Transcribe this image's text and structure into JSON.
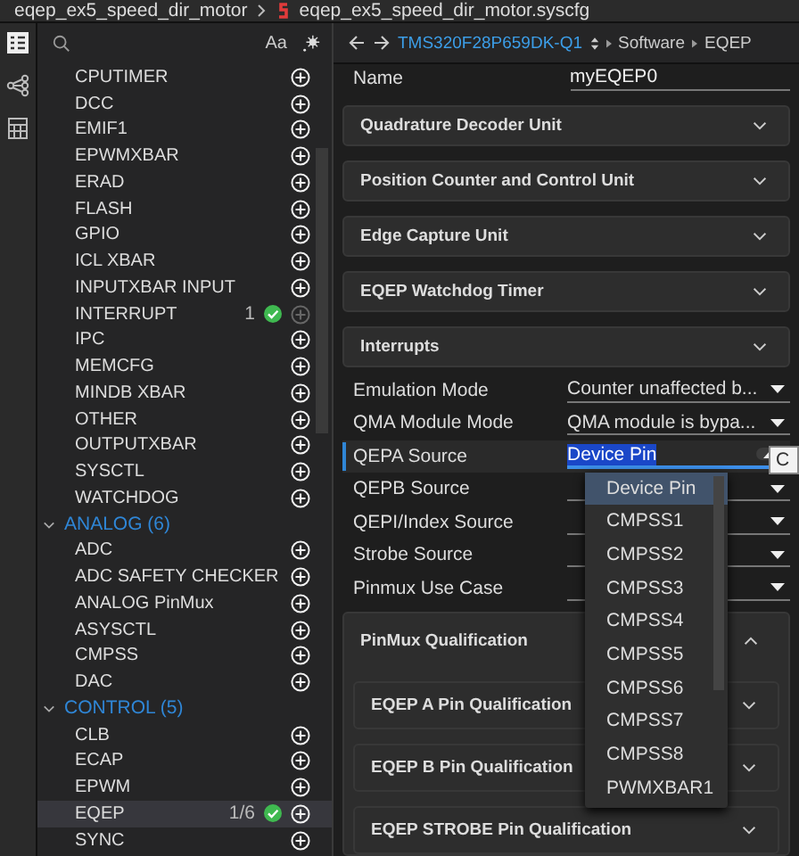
{
  "tabs": [
    {
      "label": "eqep_ex5_speed_dir_motor"
    },
    {
      "label": "eqep_ex5_speed_dir_motor.syscfg"
    }
  ],
  "search": {
    "case_label": "Aa"
  },
  "modules": [
    {
      "label": "CPUTIMER",
      "selected": false
    },
    {
      "label": "DCC",
      "selected": false
    },
    {
      "label": "EMIF1",
      "selected": false
    },
    {
      "label": "EPWMXBAR",
      "selected": false
    },
    {
      "label": "ERAD",
      "selected": false
    },
    {
      "label": "FLASH",
      "selected": false
    },
    {
      "label": "GPIO",
      "selected": false
    },
    {
      "label": "ICL XBAR",
      "selected": false
    },
    {
      "label": "INPUTXBAR INPUT",
      "selected": false
    },
    {
      "label": "INTERRUPT",
      "count": "1",
      "added": true,
      "add_disabled": true,
      "selected": false
    },
    {
      "label": "IPC",
      "selected": false
    },
    {
      "label": "MEMCFG",
      "selected": false
    },
    {
      "label": "MINDB XBAR",
      "selected": false
    },
    {
      "label": "OTHER",
      "selected": false
    },
    {
      "label": "OUTPUTXBAR",
      "selected": false
    },
    {
      "label": "SYSCTL",
      "selected": false
    },
    {
      "label": "WATCHDOG",
      "selected": false
    }
  ],
  "categories": [
    {
      "label": "ANALOG (6)",
      "expanded": true,
      "children": [
        {
          "label": "ADC",
          "selected": false
        },
        {
          "label": "ADC SAFETY CHECKER",
          "selected": false
        },
        {
          "label": "ANALOG PinMux",
          "selected": false
        },
        {
          "label": "ASYSCTL",
          "selected": false
        },
        {
          "label": "CMPSS",
          "selected": false
        },
        {
          "label": "DAC",
          "selected": false
        }
      ]
    },
    {
      "label": "CONTROL (5)",
      "expanded": true,
      "children": [
        {
          "label": "CLB",
          "selected": false
        },
        {
          "label": "ECAP",
          "selected": false
        },
        {
          "label": "EPWM",
          "selected": false
        },
        {
          "label": "EQEP",
          "count": "1/6",
          "added": true,
          "selected": true
        },
        {
          "label": "SYNC",
          "selected": false
        }
      ]
    }
  ],
  "breadcrumb": {
    "device": "TMS320F28P659DK-Q1",
    "path": [
      "Software",
      "EQEP"
    ]
  },
  "name_field": {
    "label": "Name",
    "value": "myEQEP0"
  },
  "sections": [
    {
      "title": "Quadrature Decoder Unit",
      "expanded": false
    },
    {
      "title": "Position Counter and Control Unit",
      "expanded": false
    },
    {
      "title": "Edge Capture Unit",
      "expanded": false
    },
    {
      "title": "EQEP Watchdog Timer",
      "expanded": false
    },
    {
      "title": "Interrupts",
      "expanded": false
    }
  ],
  "fields": [
    {
      "label": "Emulation Mode",
      "value": "Counter unaffected b...",
      "focused": false,
      "open": false
    },
    {
      "label": "QMA Module Mode",
      "value": "QMA module is bypa...",
      "focused": false,
      "open": false
    },
    {
      "label": "QEPA Source",
      "value": "Device Pin",
      "focused": true,
      "open": true
    },
    {
      "label": "QEPB Source",
      "focused": false,
      "open": false
    },
    {
      "label": "QEPI/Index Source",
      "focused": false,
      "open": false
    },
    {
      "label": "Strobe Source",
      "focused": false,
      "open": false
    },
    {
      "label": "Pinmux Use Case",
      "focused": false,
      "open": false
    }
  ],
  "dropdown_options": [
    {
      "label": "Device Pin",
      "selected": true
    },
    {
      "label": "CMPSS1",
      "selected": false
    },
    {
      "label": "CMPSS2",
      "selected": false
    },
    {
      "label": "CMPSS3",
      "selected": false
    },
    {
      "label": "CMPSS4",
      "selected": false
    },
    {
      "label": "CMPSS5",
      "selected": false
    },
    {
      "label": "CMPSS6",
      "selected": false
    },
    {
      "label": "CMPSS7",
      "selected": false
    },
    {
      "label": "CMPSS8",
      "selected": false
    },
    {
      "label": "PWMXBAR1",
      "selected": false
    }
  ],
  "tooltip_fragment": "C",
  "qualification": {
    "title": "PinMux Qualification",
    "expanded": true,
    "children": [
      {
        "title": "EQEP A Pin Qualification",
        "expanded": false
      },
      {
        "title": "EQEP B Pin Qualification",
        "expanded": false
      },
      {
        "title": "EQEP STROBE Pin Qualification",
        "expanded": false
      }
    ]
  }
}
